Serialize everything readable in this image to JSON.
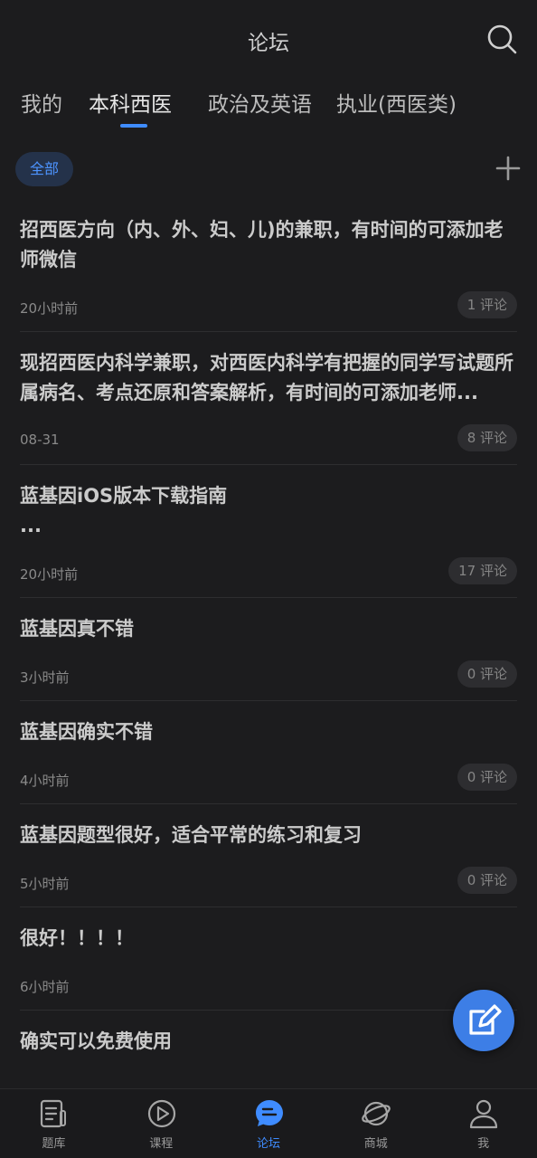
{
  "header": {
    "title": "论坛"
  },
  "tabs": [
    {
      "label": "我的"
    },
    {
      "label": "本科西医"
    },
    {
      "label": "政治及英语"
    },
    {
      "label": "执业(西医类)"
    }
  ],
  "filter": {
    "chip_label": "全部"
  },
  "posts": [
    {
      "title": "招西医方向（内、外、妇、儿)的兼职，有时间的可添加老师微信",
      "time": "20小时前",
      "comments": "1 评论"
    },
    {
      "title": "现招西医内科学兼职，对西医内科学有把握的同学写试题所属病名、考点还原和答案解析，有时间的可添加老师...",
      "time": "08-31",
      "comments": "8 评论"
    },
    {
      "title": "蓝基因iOS版本下载指南\n...",
      "time": "20小时前",
      "comments": "17 评论"
    },
    {
      "title": "蓝基因真不错",
      "time": "3小时前",
      "comments": "0 评论"
    },
    {
      "title": "蓝基因确实不错",
      "time": "4小时前",
      "comments": "0 评论"
    },
    {
      "title": "蓝基因题型很好，适合平常的练习和复习",
      "time": "5小时前",
      "comments": "0 评论"
    },
    {
      "title": "很好！！！！",
      "time": "6小时前",
      "comments": ""
    },
    {
      "title": "确实可以免费使用",
      "time": "",
      "comments": ""
    }
  ],
  "tabbar": [
    {
      "label": "题库",
      "icon": "question-bank-icon"
    },
    {
      "label": "课程",
      "icon": "play-icon"
    },
    {
      "label": "论坛",
      "icon": "chat-icon"
    },
    {
      "label": "商城",
      "icon": "planet-icon"
    },
    {
      "label": "我",
      "icon": "person-icon"
    }
  ],
  "colors": {
    "accent": "#3f8cff",
    "background": "#1c1c1e",
    "fab": "#3d7ee6"
  }
}
